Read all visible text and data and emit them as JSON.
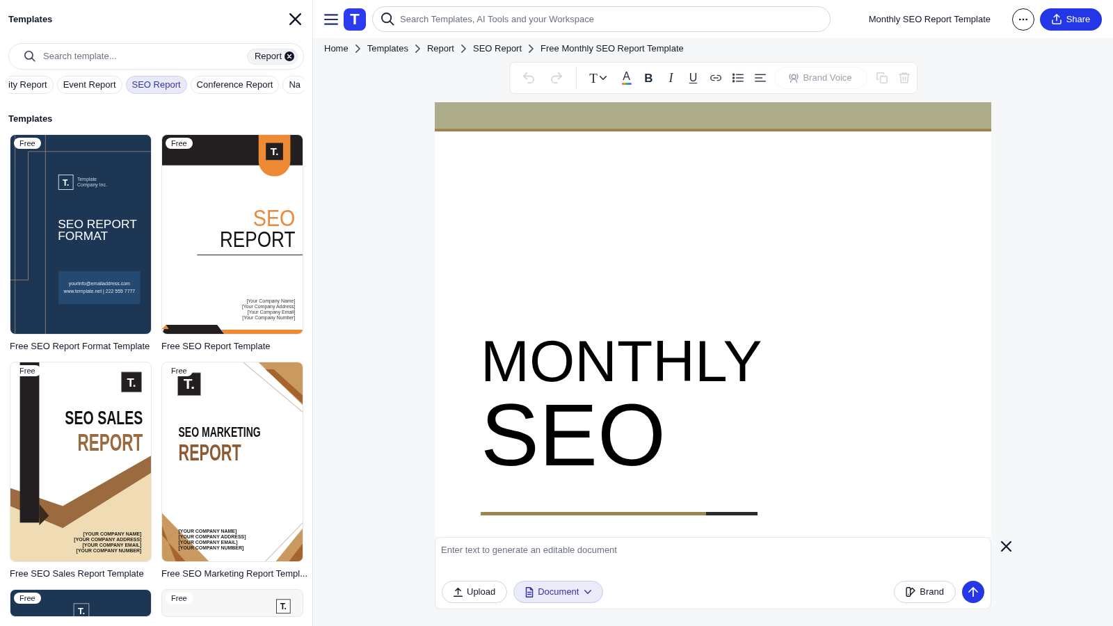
{
  "templates_panel": {
    "title": "Templates",
    "search": {
      "placeholder": "Search template...",
      "filter_chip": "Report"
    },
    "tags": [
      {
        "label": "ity Report",
        "selected": false
      },
      {
        "label": "Event Report",
        "selected": false
      },
      {
        "label": "SEO Report",
        "selected": true
      },
      {
        "label": "Conference Report",
        "selected": false
      },
      {
        "label": "Na",
        "selected": false
      }
    ],
    "section_title": "Templates",
    "cards": [
      {
        "kind": "navy_format",
        "badge": "Free",
        "caption": "Free SEO Report Format Template",
        "logo": "T.",
        "company": [
          "Template",
          "Company Inc."
        ],
        "title": [
          "SEO REPORT",
          "FORMAT"
        ],
        "contact": [
          "yourinfo@emailaddress.com",
          "www.template.net | 222 555 7777"
        ]
      },
      {
        "kind": "orange_corner",
        "badge": "Free",
        "caption": "Free SEO Report Template",
        "logo": "T.",
        "title": [
          "SEO",
          "REPORT"
        ],
        "contact": [
          "[Your Company Name]",
          "[Your Company Address]",
          "[Your Company Email]",
          "[Your Company Number]"
        ]
      },
      {
        "kind": "tan_chevron",
        "badge": "Free",
        "caption": "Free SEO Sales Report Template",
        "logo": "T.",
        "title": [
          "SEO SALES",
          "REPORT"
        ],
        "contact": [
          "[YOUR COMPANY NAME]",
          "[YOUR COMPANY ADDRESS]",
          "[YOUR COMPANY EMAIL]",
          "[YOUR COMPANY NUMBER]"
        ]
      },
      {
        "kind": "brown_corner",
        "badge": "Free",
        "caption": "Free SEO Marketing Report Templ...",
        "logo": "T.",
        "title": [
          "SEO MARKETING",
          "REPORT"
        ],
        "contact": [
          "[YOUR COMPANY NAME]",
          "[YOUR COMPANY ADDRESS]",
          "[YOUR COMPANY EMAIL]",
          "[YOUR COMPANY NUMBER]"
        ]
      },
      {
        "kind": "navy_logo",
        "badge": "Free",
        "logo": "T."
      },
      {
        "kind": "plain_logo",
        "badge": "Free",
        "logo": "T."
      }
    ]
  },
  "top_bar": {
    "logo": "T",
    "search": {
      "placeholder": "Search Templates, AI Tools and your Workspace"
    },
    "document_title": "Monthly SEO Report Template",
    "share_button": "Share"
  },
  "breadcrumbs": [
    "Home",
    "Templates",
    "Report",
    "SEO Report",
    "Free Monthly SEO Report Template"
  ],
  "toolbar": {
    "undo": {
      "disabled": true
    },
    "redo": {
      "disabled": true
    },
    "text_style": "T",
    "text_color": "A",
    "bold": "B",
    "italic": "I",
    "underline": "U",
    "brand_voice": {
      "label": "Brand Voice",
      "disabled": true
    },
    "duplicate": {
      "disabled": true
    },
    "delete": {
      "disabled": true
    }
  },
  "document": {
    "title_small": "MONTHLY",
    "title_large": "SEO"
  },
  "prompt": {
    "placeholder": "Enter text to generate an editable document",
    "upload_button": "Upload",
    "type_dropdown": "Document",
    "brand_button": "Brand"
  }
}
